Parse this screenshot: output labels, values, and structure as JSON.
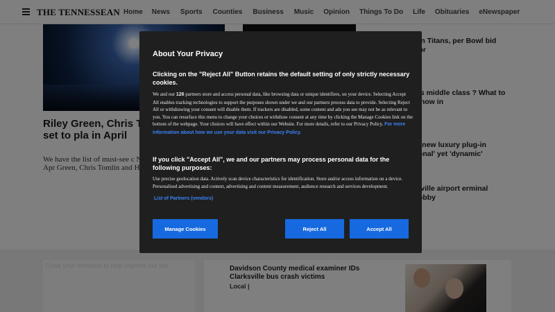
{
  "header": {
    "logo": "THE TENNESSEAN",
    "nav": [
      "Home",
      "News",
      "Sports",
      "Counties",
      "Business",
      "Music",
      "Opinion",
      "Things To Do",
      "Life",
      "Obituaries",
      "eNewspaper"
    ]
  },
  "hero": {
    "title": "Riley Green, Chris Tom Breland, all set to pla in April",
    "desc": "We have the list of must-see c Nashville for the month of Apr Green, Chris Tomlin and Hayle"
  },
  "right_stories": [
    "on Titans, per Bowl bid for",
    "as middle class ? What to know in",
    "z new luxury plug-in ional' yet 'dynamic'",
    "hville airport erminal lobby"
  ],
  "ghost_text": "Close your feedback to help improve our site",
  "story": {
    "title": "Davidson County medical examiner IDs Clarksville bus crash victims",
    "tag": "Local",
    "separator": "|"
  },
  "modal": {
    "title": "About Your Privacy",
    "section1_head": "Clicking on the \"Reject All\" Button retains the default setting of only strictly necessary cookies.",
    "section1_pre": "We and our ",
    "section1_count": "126",
    "section1_post": " partners store and access personal data, like browsing data or unique identifiers, on your device. Selecting Accept All enables tracking technologies to support the purposes shown under we and our partners process data to provide. Selecting Reject All or withdrawing your consent will disable them. If trackers are disabled, some content and ads you see may not be as relevant to you. You can resurface this menu to change your choices or withdraw consent at any time by clicking the Manage Cookies link on the bottom of the webpage. Your choices will have effect within our Website. For more details, refer to our Privacy Policy. ",
    "more_link": "For more information about how we use your data visit our Privacy Policy.",
    "section2_head": "If you click \"Accept All\", we and our partners may process personal data for the following purposes:",
    "section2_body": "Use precise geolocation data. Actively scan device characteristics for identification. Store and/or access information on a device. Personalised advertising and content, advertising and content measurement, audience research and services development.",
    "partners_link": "List of Partners (vendors)",
    "btn_manage": "Manage Cookies",
    "btn_reject": "Reject All",
    "btn_accept": "Accept All",
    "button_color": "#1769e0",
    "link_color": "#3b82f6"
  }
}
